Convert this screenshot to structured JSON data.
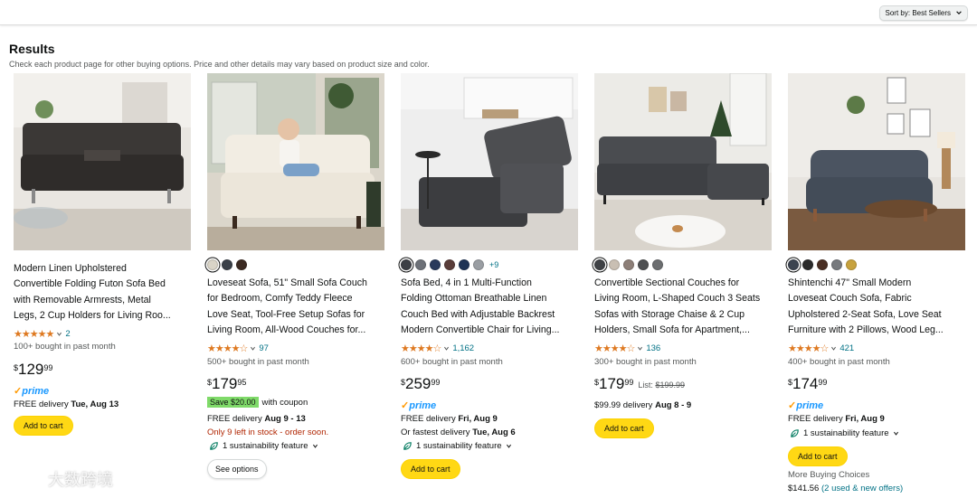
{
  "sort": {
    "label": "Sort by:",
    "value": "Best Sellers"
  },
  "results": {
    "title": "Results",
    "subtitle": "Check each product page for other buying options. Price and other details may vary based on product size and color."
  },
  "products": [
    {
      "title_lines": [
        "Modern Linen Upholstered",
        "Convertible Folding Futon Sofa Bed",
        "with Removable Armrests, Metal",
        "Legs, 2 Cup Holders for Living Roo..."
      ],
      "stars": "★★★★★",
      "rating_count": "2",
      "bought": "100+ bought in past month",
      "price": {
        "symbol": "$",
        "whole": "129",
        "fraction": "99"
      },
      "prime": "prime",
      "delivery": {
        "prefix": "FREE delivery",
        "date": "Tue, Aug 13"
      },
      "button": "Add to cart"
    },
    {
      "swatch_colors": [
        "#d9d4c7",
        "#3a4048",
        "#3b2a22"
      ],
      "title_lines": [
        "Loveseat Sofa, 51\" Small Sofa Couch",
        "for Bedroom, Comfy Teddy Fleece",
        "Love Seat, Tool-Free Setup Sofas for",
        "Living Room, All-Wood Couches for..."
      ],
      "stars": "★★★★☆",
      "rating_count": "97",
      "bought": "500+ bought in past month",
      "price": {
        "symbol": "$",
        "whole": "179",
        "fraction": "95"
      },
      "coupon": {
        "badge": "Save $20.00",
        "text": "with coupon"
      },
      "delivery": {
        "prefix": "FREE delivery",
        "date": "Aug 9 - 13"
      },
      "stock": "Only 9 left in stock - order soon.",
      "sustainability": "1 sustainability feature",
      "button": "See options"
    },
    {
      "swatch_colors": [
        "#3c3f45",
        "#6d7178",
        "#2a3a5c",
        "#5a3d3a",
        "#1e3355",
        "#9a9ea3"
      ],
      "more_swatches": "+9",
      "title_lines": [
        "Sofa Bed, 4 in 1 Multi-Function",
        "Folding Ottoman Breathable Linen",
        "Couch Bed with Adjustable Backrest",
        "Modern Convertible Chair for Living..."
      ],
      "stars": "★★★★☆",
      "rating_count": "1,162",
      "bought": "600+ bought in past month",
      "price": {
        "symbol": "$",
        "whole": "259",
        "fraction": "99"
      },
      "prime": "prime",
      "delivery": {
        "prefix": "FREE delivery",
        "date": "Fri, Aug 9"
      },
      "fastest": {
        "prefix": "Or fastest delivery",
        "date": "Tue, Aug 6"
      },
      "sustainability": "1 sustainability feature",
      "button": "Add to cart"
    },
    {
      "swatch_colors": [
        "#3f4246",
        "#c9bfb3",
        "#8d7f78",
        "#4f5052",
        "#6c6e70"
      ],
      "title_lines": [
        "Convertible Sectional Couches for",
        "Living Room, L-Shaped Couch 3 Seats",
        "Sofas with Storage Chaise & 2 Cup",
        "Holders, Small Sofa for Apartment,..."
      ],
      "stars": "★★★★☆",
      "rating_count": "136",
      "bought": "300+ bought in past month",
      "price": {
        "symbol": "$",
        "whole": "179",
        "fraction": "99",
        "list_label": "List:",
        "list_price": "$199.99"
      },
      "delivery": {
        "prefix": "$99.99 delivery",
        "date": "Aug 8 - 9"
      },
      "button": "Add to cart"
    },
    {
      "swatch_colors": [
        "#3c4450",
        "#2b2b2b",
        "#4a2f24",
        "#777a7e",
        "#c7a23e"
      ],
      "title_lines": [
        "Shintenchi 47\" Small Modern",
        "Loveseat Couch Sofa, Fabric",
        "Upholstered 2-Seat Sofa, Love Seat",
        "Furniture with 2 Pillows, Wood Leg..."
      ],
      "stars": "★★★★☆",
      "rating_count": "421",
      "bought": "400+ bought in past month",
      "price": {
        "symbol": "$",
        "whole": "174",
        "fraction": "99"
      },
      "prime": "prime",
      "delivery": {
        "prefix": "FREE delivery",
        "date": "Fri, Aug 9"
      },
      "sustainability": "1 sustainability feature",
      "button": "Add to cart",
      "more_buying": {
        "label": "More Buying Choices",
        "price": "$141.56",
        "offers": "(2 used & new offers)"
      }
    }
  ],
  "watermark": "大数跨境",
  "colors": {
    "star": "#de7921",
    "link": "#007185",
    "cart_button": "#ffd814",
    "prime": "#1a98ff",
    "alert": "#b12704"
  }
}
